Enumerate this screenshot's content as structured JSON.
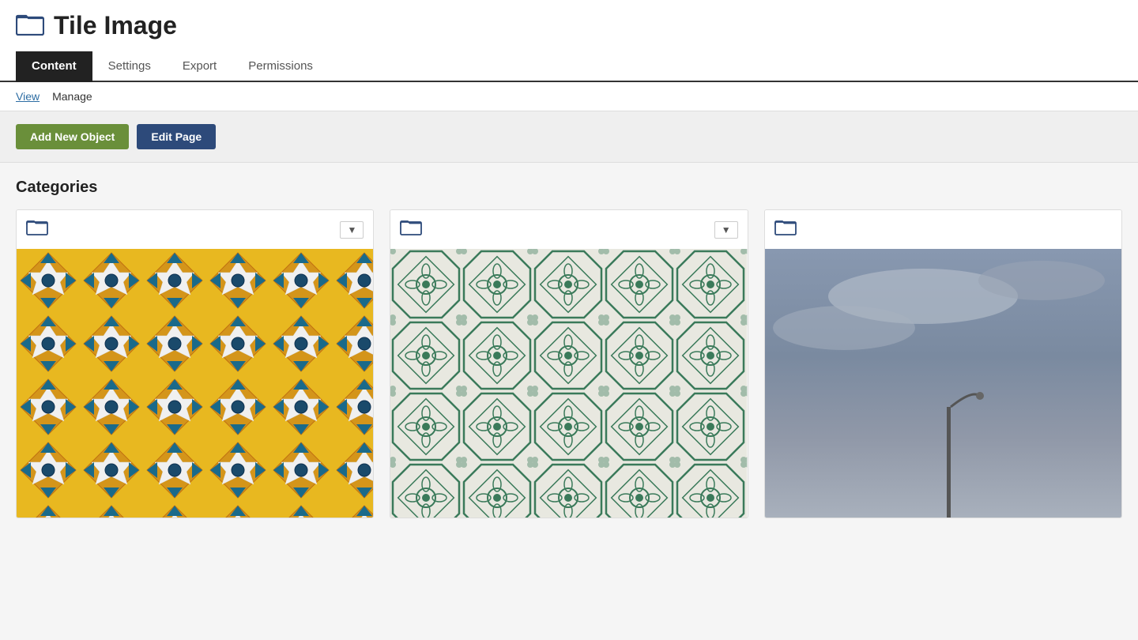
{
  "header": {
    "title": "Tile Image",
    "icon_name": "folder-icon"
  },
  "tabs": [
    {
      "id": "content",
      "label": "Content",
      "active": true
    },
    {
      "id": "settings",
      "label": "Settings",
      "active": false
    },
    {
      "id": "export",
      "label": "Export",
      "active": false
    },
    {
      "id": "permissions",
      "label": "Permissions",
      "active": false
    }
  ],
  "sub_nav": [
    {
      "id": "view",
      "label": "View",
      "underline": true
    },
    {
      "id": "manage",
      "label": "Manage",
      "underline": false
    }
  ],
  "action_buttons": {
    "add_new_object": "Add New Object",
    "edit_page": "Edit Page"
  },
  "section": {
    "title": "Categories"
  },
  "cards": [
    {
      "id": "card-1",
      "has_dropdown": true,
      "image_type": "tile-yellow",
      "alt": "Yellow and teal decorative tile pattern"
    },
    {
      "id": "card-2",
      "has_dropdown": true,
      "image_type": "tile-green",
      "alt": "Green and white ornate tile pattern"
    },
    {
      "id": "card-3",
      "has_dropdown": false,
      "image_type": "tile-sky",
      "alt": "Overcast sky with streetlight"
    }
  ],
  "icons": {
    "folder": "🗂",
    "dropdown_arrow": "▾"
  }
}
